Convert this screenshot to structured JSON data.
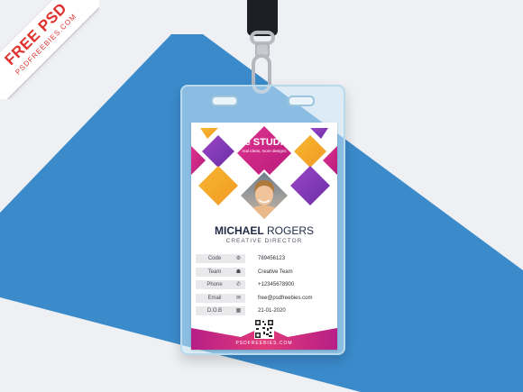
{
  "badge": {
    "title": "FREE PSD",
    "subtitle": "PSDFREEBIES.COM"
  },
  "brand": {
    "name": "Bē STUDIO",
    "tagline": "real ideas, more designs"
  },
  "person": {
    "first_name": "MICHAEL",
    "last_name": "ROGERS",
    "title": "CREATIVE DIRECTOR"
  },
  "details": [
    {
      "label": "Code",
      "icon": "gear-icon",
      "glyph": "⚙",
      "value": "789456123"
    },
    {
      "label": "Team",
      "icon": "team-icon",
      "glyph": "☗",
      "value": "Creative Team"
    },
    {
      "label": "Phone",
      "icon": "phone-icon",
      "glyph": "✆",
      "value": "+12345678900"
    },
    {
      "label": "Email",
      "icon": "envelope-icon",
      "glyph": "✉",
      "value": "free@psdfreebies.com"
    },
    {
      "label": "D.O.B",
      "icon": "calendar-icon",
      "glyph": "▦",
      "value": "21-01-2020"
    }
  ],
  "footer": {
    "text": "PSDFREEBIES.COM"
  },
  "colors": {
    "background_white": "#f2f3f5",
    "background_blue": "#3b8bcb",
    "orange": "#f4a62a",
    "magenta": "#d6218f",
    "purple": "#7b3fbb",
    "pink": "#e23a7a",
    "navy": "#1f2a44"
  }
}
